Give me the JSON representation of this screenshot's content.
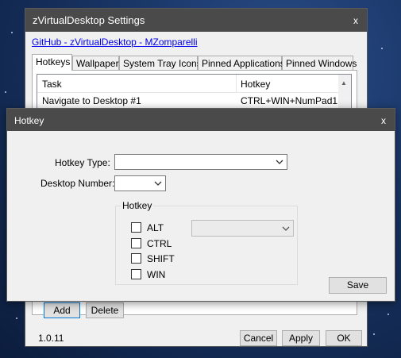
{
  "main_window": {
    "title": "zVirtualDesktop Settings",
    "close_glyph": "x",
    "github_link": "GitHub - zVirtualDesktop - MZomparelli",
    "tabs": [
      {
        "label": "Hotkeys",
        "active": true
      },
      {
        "label": "Wallpaper",
        "active": false
      },
      {
        "label": "System Tray Icons",
        "active": false
      },
      {
        "label": "Pinned Applications",
        "active": false
      },
      {
        "label": "Pinned Windows",
        "active": false
      }
    ],
    "hotkeys_table": {
      "columns": [
        "Task",
        "Hotkey"
      ],
      "rows": [
        {
          "task": "Navigate to Desktop #1",
          "hotkey": "CTRL+WIN+NumPad1"
        }
      ]
    },
    "add_button": "Add",
    "delete_button": "Delete",
    "version": "1.0.11",
    "cancel_button": "Cancel",
    "apply_button": "Apply",
    "ok_button": "OK"
  },
  "hotkey_dialog": {
    "title": "Hotkey",
    "close_glyph": "x",
    "hotkey_type_label": "Hotkey Type:",
    "hotkey_type_value": "",
    "desktop_number_label": "Desktop Number:",
    "desktop_number_value": "",
    "group_label": "Hotkey",
    "modifiers": [
      {
        "label": "ALT",
        "checked": false
      },
      {
        "label": "CTRL",
        "checked": false
      },
      {
        "label": "SHIFT",
        "checked": false
      },
      {
        "label": "WIN",
        "checked": false
      }
    ],
    "key_value": "",
    "save_button": "Save"
  },
  "colors": {
    "titlebar": "#4a4a4a",
    "window_bg": "#f0f0f0",
    "link": "#0000ee",
    "focus_border": "#0078d7"
  }
}
